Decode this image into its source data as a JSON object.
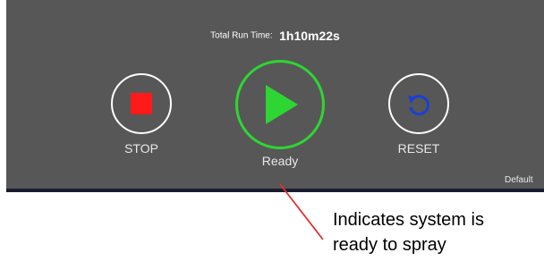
{
  "panel": {
    "run_time_label": "Total Run Time:",
    "run_time_value": "1h10m22s",
    "default_label": "Default"
  },
  "controls": {
    "stop": {
      "label": "STOP",
      "icon": "stop-square-icon",
      "color": "#ff1a1a"
    },
    "play": {
      "status": "Ready",
      "icon": "play-triangle-icon",
      "color": "#2ed633"
    },
    "reset": {
      "label": "RESET",
      "icon": "reset-arrow-icon",
      "color": "#1a3fd6"
    }
  },
  "callout": {
    "line1": "Indicates system is",
    "line2": "ready to spray",
    "line_color": "#e03030"
  }
}
